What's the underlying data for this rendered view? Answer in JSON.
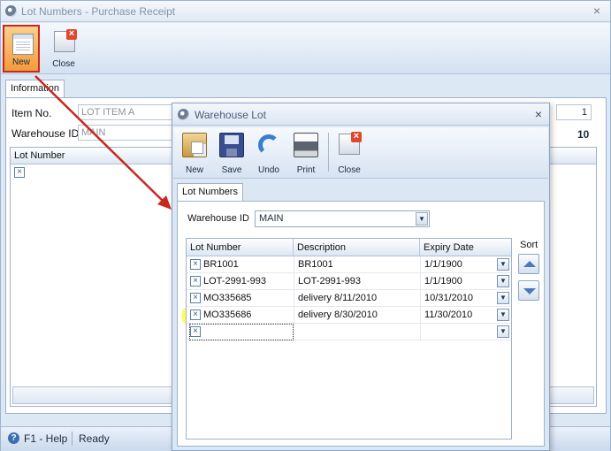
{
  "window": {
    "title": "Lot Numbers - Purchase Receipt",
    "close_glyph": "×",
    "toolbar": {
      "new_label": "New",
      "close_label": "Close"
    },
    "tab": "Information",
    "fields": {
      "item_no_label": "Item No.",
      "item_no_value": "LOT ITEM A",
      "warehouse_label": "Warehouse ID",
      "warehouse_value": "MAIN",
      "qty_value": "1",
      "total_value": "10"
    },
    "grid": {
      "column": "Lot Number",
      "row_marker": "×"
    },
    "status": {
      "help": "F1 - Help",
      "ready": "Ready",
      "help_glyph": "?"
    }
  },
  "dialog": {
    "title": "Warehouse Lot",
    "close_glyph": "×",
    "toolbar": {
      "new_label": "New",
      "save_label": "Save",
      "undo_label": "Undo",
      "print_label": "Print",
      "close_label": "Close"
    },
    "tab": "Lot Numbers",
    "warehouse_label": "Warehouse ID",
    "warehouse_value": "MAIN",
    "dropdown_glyph": "▼",
    "row_marker": "×",
    "grid": {
      "columns": [
        "Lot Number",
        "Description",
        "Expiry Date"
      ],
      "rows": [
        {
          "lot": "BR1001",
          "description": "BR1001",
          "expiry": "1/1/1900"
        },
        {
          "lot": "LOT-2991-993",
          "description": "LOT-2991-993",
          "expiry": "1/1/1900"
        },
        {
          "lot": "MO335685",
          "description": "delivery 8/11/2010",
          "expiry": "10/31/2010"
        },
        {
          "lot": "MO335686",
          "description": "delivery 8/30/2010",
          "expiry": "11/30/2010"
        }
      ],
      "highlighted_row": 3
    },
    "sort_label": "Sort"
  },
  "colors": {
    "annotation_red": "#c8281e",
    "highlight_yellow": "#f6ff3c",
    "accent_blue": "#4a78b8"
  },
  "icons": [
    "window-icon",
    "new-document-icon",
    "close-icon",
    "box-icon",
    "save-icon",
    "undo-icon",
    "print-icon",
    "help-icon",
    "sort-up-icon",
    "sort-down-icon",
    "dropdown-arrow-icon"
  ]
}
